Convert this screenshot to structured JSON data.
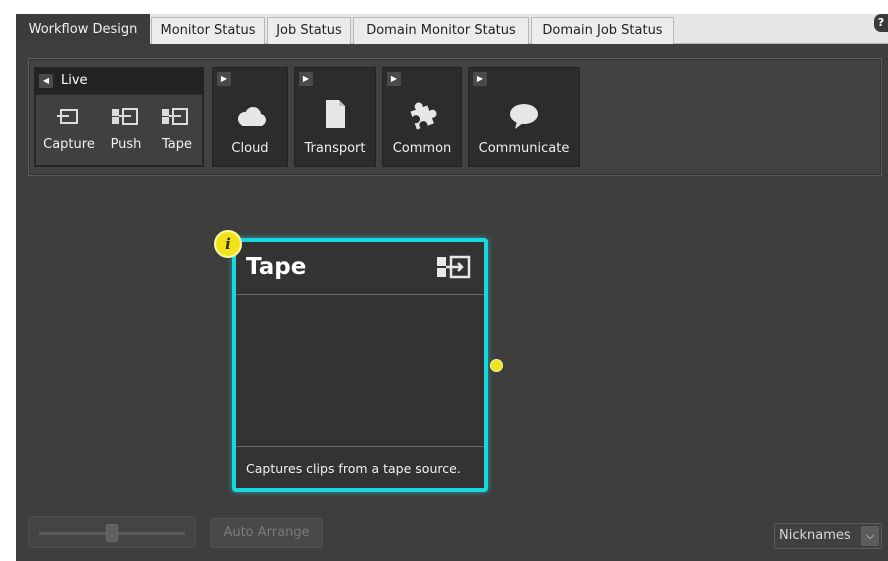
{
  "tabs": [
    {
      "label": "Workflow Design",
      "active": true
    },
    {
      "label": "Monitor Status",
      "active": false
    },
    {
      "label": "Job Status",
      "active": false
    },
    {
      "label": "Domain Monitor Status",
      "active": false
    },
    {
      "label": "Domain Job Status",
      "active": false
    }
  ],
  "help_label": "?",
  "palette": {
    "live": {
      "label": "Live",
      "items": [
        {
          "label": "Capture",
          "icon": "capture-icon"
        },
        {
          "label": "Push",
          "icon": "push-icon"
        },
        {
          "label": "Tape",
          "icon": "tape-icon"
        }
      ]
    },
    "groups": [
      {
        "label": "Cloud",
        "icon": "cloud-icon"
      },
      {
        "label": "Transport",
        "icon": "document-icon"
      },
      {
        "label": "Common",
        "icon": "puzzle-icon"
      },
      {
        "label": "Communicate",
        "icon": "speech-bubble-icon"
      }
    ]
  },
  "node": {
    "title": "Tape",
    "description": "Captures clips from a tape source.",
    "info_label": "i",
    "icon": "tape-icon",
    "border_color": "#18d8de",
    "port_color": "#f0e21c"
  },
  "bottom": {
    "auto_arrange_label": "Auto Arrange",
    "view_select": "Nicknames",
    "zoom_level": 0.5
  }
}
